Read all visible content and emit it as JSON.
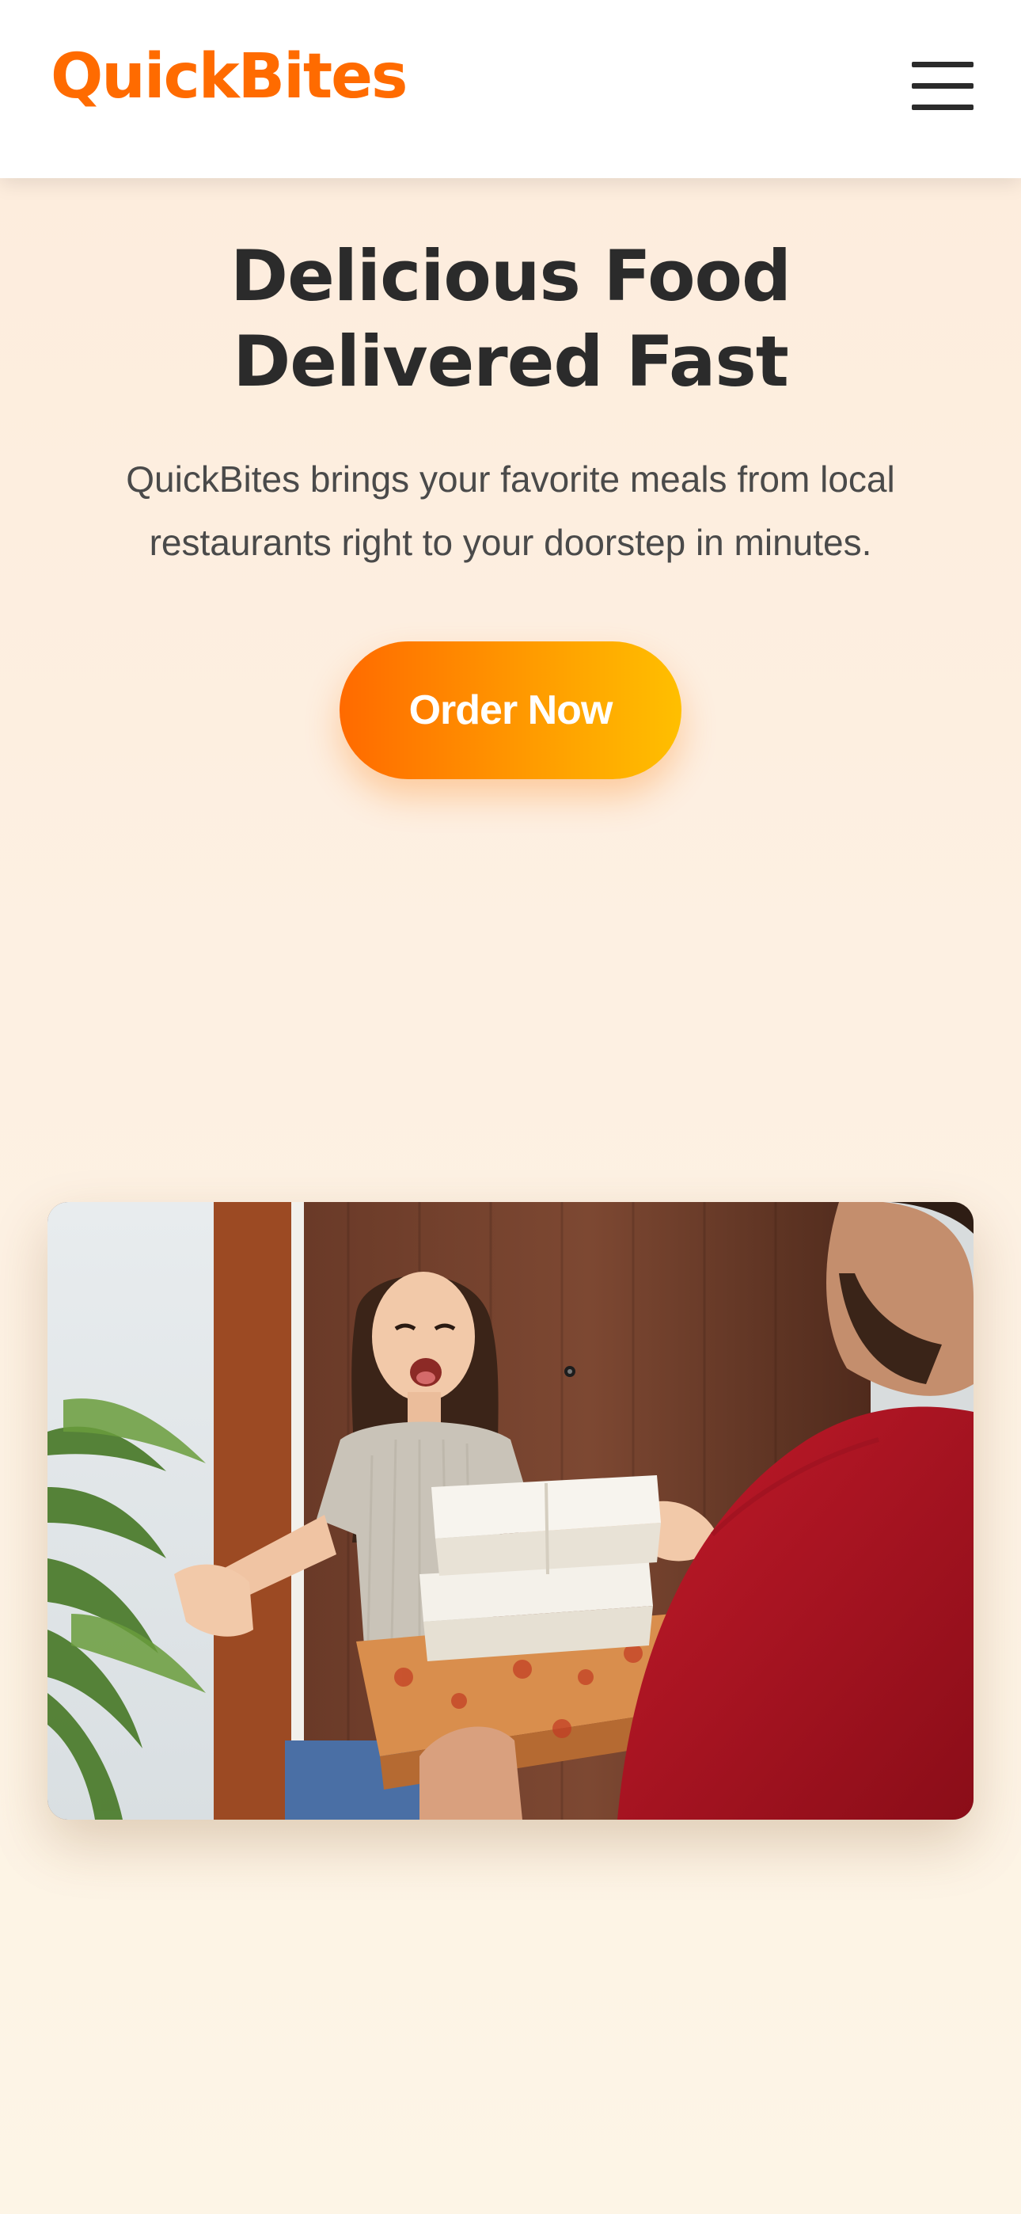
{
  "header": {
    "logo": "QuickBites",
    "menu_icon": "hamburger-menu-icon"
  },
  "hero": {
    "title": "Delicious Food Delivered Fast",
    "subtitle": "QuickBites brings your favorite meals from local restaurants right to your doorstep in minutes.",
    "cta_label": "Order Now"
  },
  "colors": {
    "brand": "#ff6b00",
    "cta_gradient_start": "#ff6a00",
    "cta_gradient_end": "#ffbf00",
    "heading": "#2b2b2b",
    "body_text": "#4a4a4a"
  }
}
